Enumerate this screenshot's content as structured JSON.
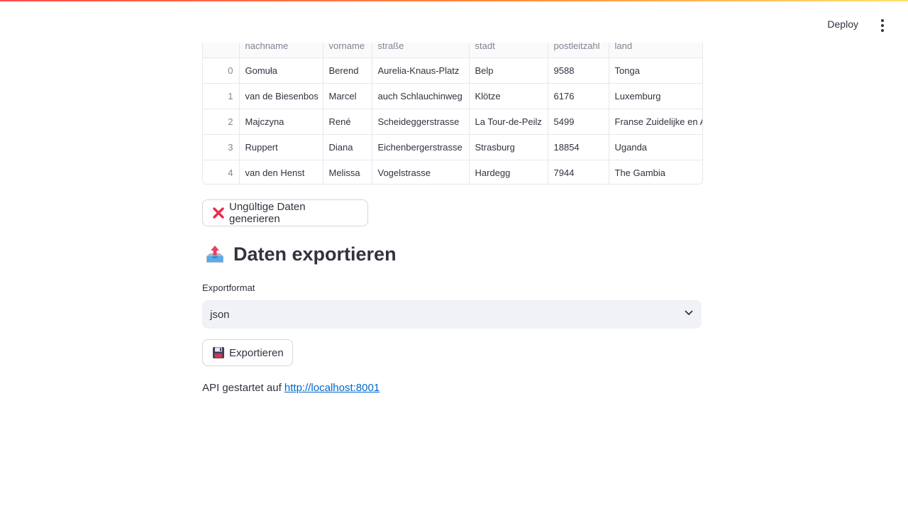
{
  "header": {
    "deploy_label": "Deploy",
    "menu_icon": "kebab-menu-icon"
  },
  "table": {
    "columns": [
      "",
      "nachname",
      "vorname",
      "straße",
      "stadt",
      "postleitzahl",
      "land"
    ],
    "rows": [
      [
        "0",
        "Gomuła",
        "Berend",
        "Aurelia-Knaus-Platz",
        "Belp",
        "9588",
        "Tonga"
      ],
      [
        "1",
        "van de Biesenbos",
        "Marcel",
        "auch Schlauchinweg",
        "Klötze",
        "6176",
        "Luxemburg"
      ],
      [
        "2",
        "Majczyna",
        "René",
        "Scheideggerstrasse",
        "La Tour-de-Peilz",
        "5499",
        "Franse Zuidelijke en Antarctische Gebieden"
      ],
      [
        "3",
        "Ruppert",
        "Diana",
        "Eichenbergerstrasse",
        "Strasburg",
        "18854",
        "Uganda"
      ],
      [
        "4",
        "van den Henst",
        "Melissa",
        "Vogelstrasse",
        "Hardegg",
        "7944",
        "The Gambia"
      ]
    ]
  },
  "invalid_button": {
    "label": "Ungültige Daten generieren",
    "icon": "cross-mark-icon"
  },
  "export_section": {
    "heading": "Daten exportieren",
    "heading_icon": "outbox-tray-icon",
    "format_label": "Exportformat",
    "format_value": "json",
    "export_button_label": "Exportieren",
    "export_button_icon": "floppy-disk-icon"
  },
  "api": {
    "text": "API gestartet auf",
    "link": "http://localhost:8001"
  },
  "colors": {
    "accent_link": "#0068c9",
    "text": "#31333f",
    "select_bg": "#f0f2f6"
  }
}
